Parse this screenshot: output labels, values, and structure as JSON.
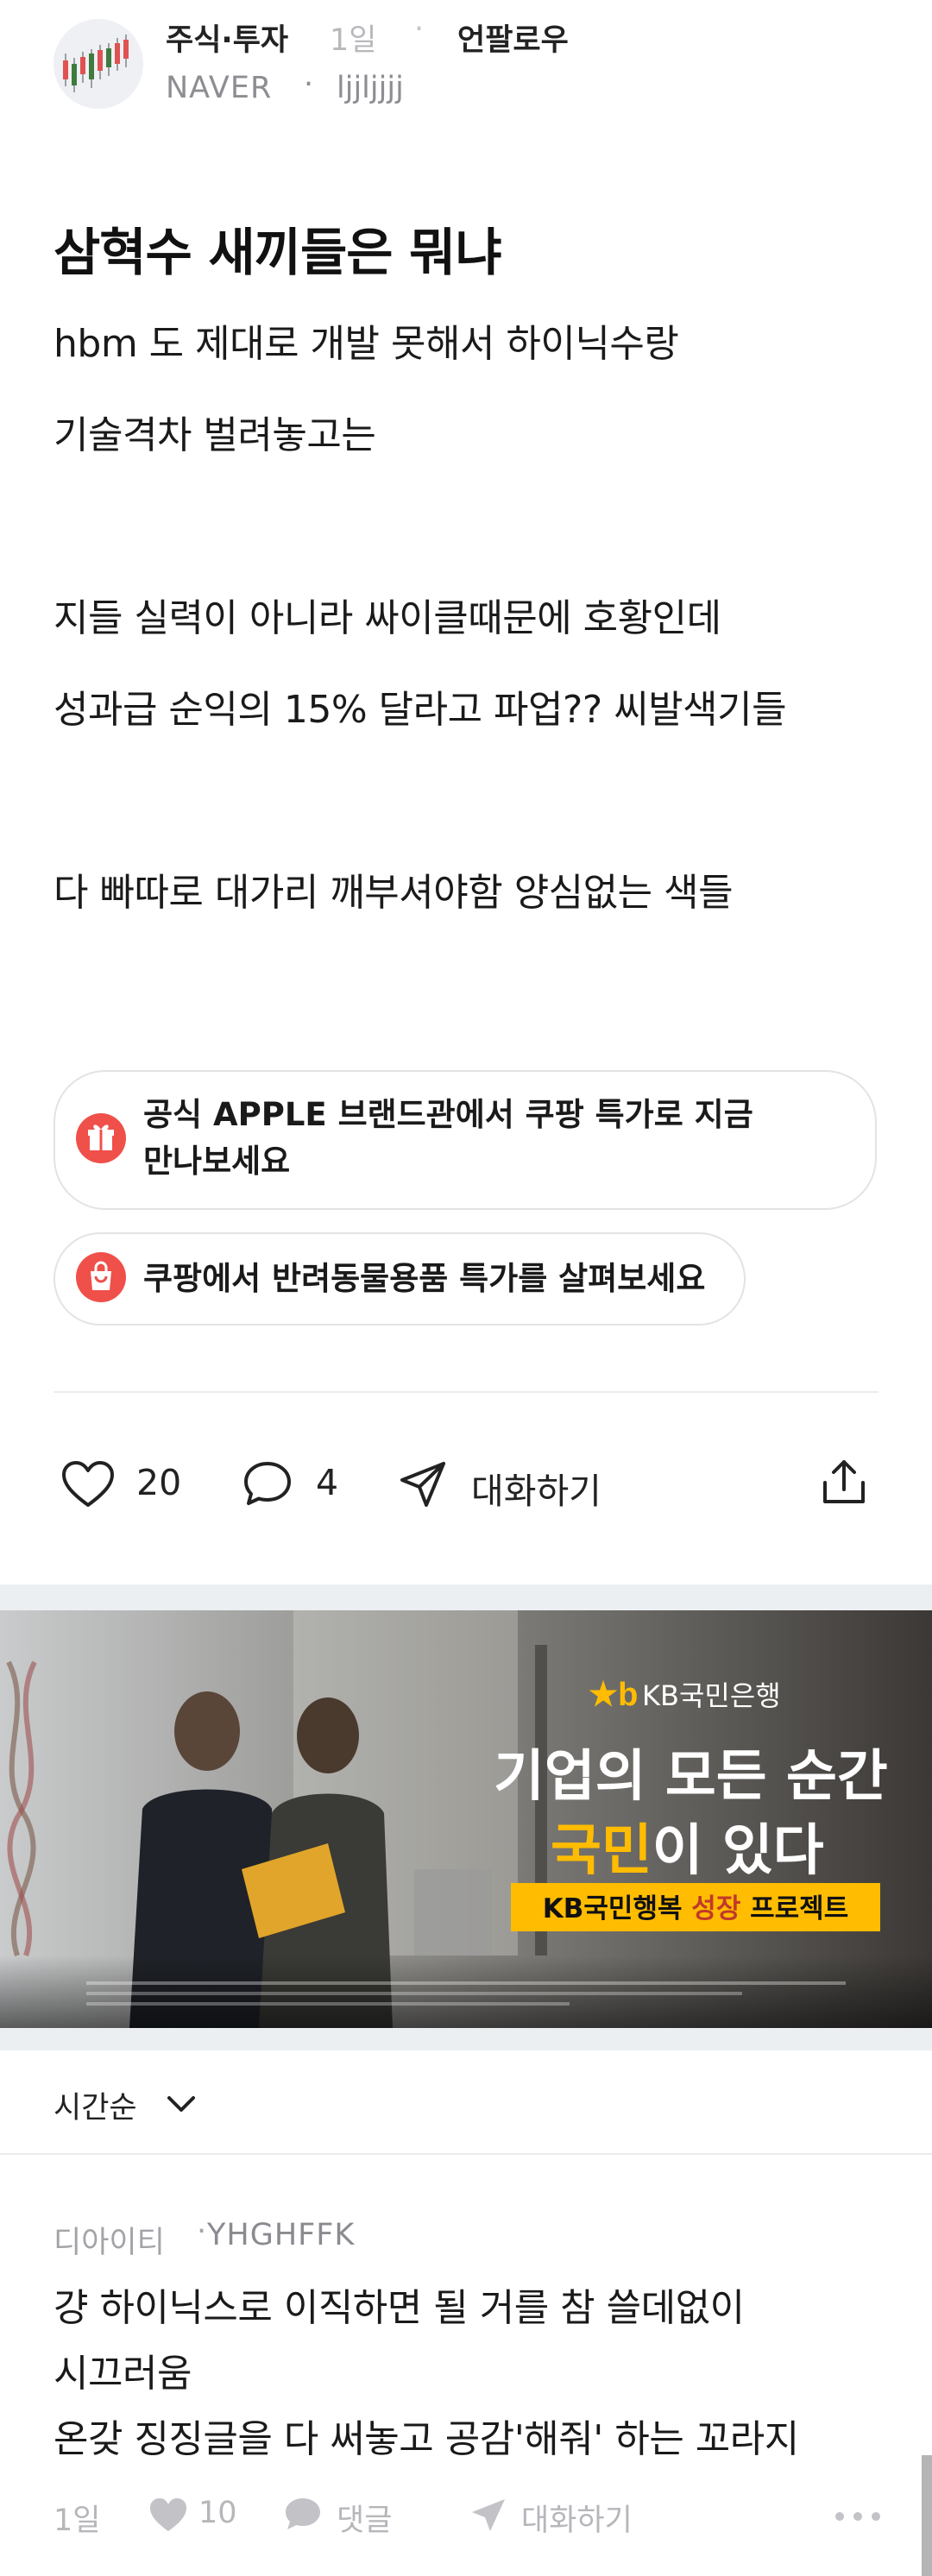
{
  "header": {
    "category": "주식·투자",
    "time": "1일",
    "follow_label": "언팔로우",
    "company": "NAVER",
    "nickname": "ljjljjjj"
  },
  "post": {
    "title": "삼혁수 새끼들은 뭐냐",
    "lines": [
      "hbm 도 제대로 개발 못해서 하이닉수랑",
      "기술격차 벌려놓고는",
      "지들 실력이 아니라 싸이클때문에 호황인데",
      "성과급 순익의 15% 달라고 파업?? 씨발색기들",
      "다 빠따로 대가리 깨부셔야함 양심없는 색들"
    ]
  },
  "chips": [
    {
      "label_1": "공식 APPLE 브랜드관에서 쿠팡 특가로 지금",
      "label_2": "만나보세요",
      "icon": "gift-icon"
    },
    {
      "label_1": "쿠팡에서 반려동물용품 특가를 살펴보세요",
      "icon": "shopping-bag-icon"
    }
  ],
  "actions": {
    "likes": "20",
    "comments": "4",
    "chat_label": "대화하기",
    "icons": [
      "heart-icon",
      "comment-icon",
      "send-icon",
      "share-icon"
    ]
  },
  "ad": {
    "brand": "KB국민은행",
    "headline_1": "기업의 모든 순간",
    "headline_2_highlight": "국민",
    "headline_2_rest": "이 있다",
    "banner_pre": "KB국민행복 ",
    "banner_highlight": "성장",
    "banner_post": " 프로젝트",
    "brand_color": "#ffbc00"
  },
  "sort": {
    "label": "시간순"
  },
  "comment": {
    "user": "디아이티",
    "nickname": "YHGHFFK",
    "lines": [
      "걍 하이닉스로 이직하면 될 거를 참 쓸데없이",
      "시끄러움",
      "온갖 징징글을 다 써놓고 공감'해줘' 하는 꼬라지"
    ],
    "time": "1일",
    "likes": "10",
    "reply_label": "댓글",
    "chat_label": "대화하기"
  }
}
